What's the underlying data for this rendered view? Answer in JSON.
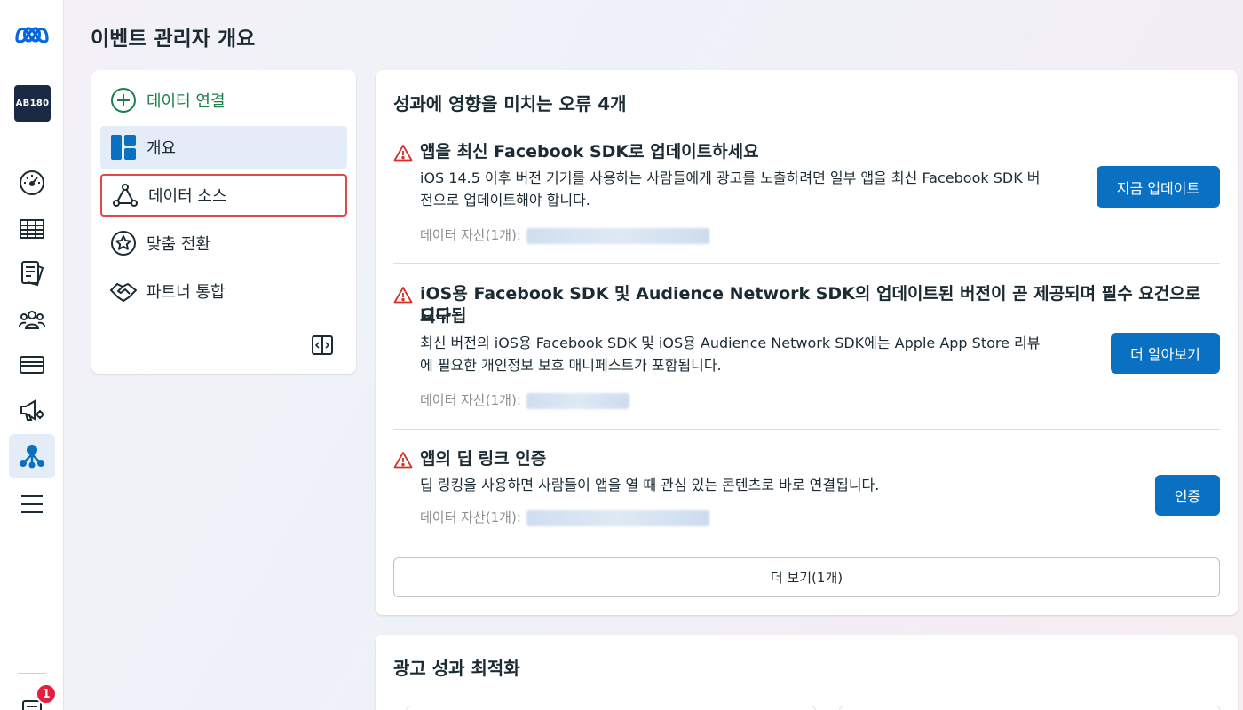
{
  "rail": {
    "account_label": "AB180",
    "notification_count": "1",
    "icons": [
      "meta-logo-icon",
      "dashboard-gauge-icon",
      "table-icon",
      "reports-icon",
      "audiences-icon",
      "billing-card-icon",
      "ads-megaphone-icon",
      "events-manager-icon",
      "menu-icon",
      "notifications-icon"
    ]
  },
  "page": {
    "title": "이벤트 관리자 개요"
  },
  "menu": {
    "connect": "데이터 연결",
    "overview": "개요",
    "data_sources": "데이터 소스",
    "custom_conversions": "맞춤 전환",
    "partner_integrations": "파트너 통합"
  },
  "issues_card": {
    "heading": "성과에 영향을 미치는 오류 4개",
    "issues": [
      {
        "title": "앱을 최신 Facebook SDK로 업데이트하세요",
        "desc_line1": "iOS 14.5 이후 버전 기기를 사용하는 사람들에게 광고를 노출하려면 일부 앱을 최신 Facebook SDK 버",
        "desc_line2": "전으로 업데이트해야 합니다.",
        "asset_label": "데이터 자산(1개):",
        "button": "지금 업데이트"
      },
      {
        "title_line1": "iOS용 Facebook SDK 및 Audience Network SDK의 업데이트된 버전이 곧 제공되며 필수 요건으로 요구됩",
        "title_line2": "니다",
        "desc_line1": "최신 버전의 iOS용 Facebook SDK 및 iOS용 Audience Network SDK에는 Apple App Store 리뷰",
        "desc_line2": "에 필요한 개인정보 보호 매니페스트가 포함됩니다.",
        "asset_label": "데이터 자산(1개):",
        "button": "더 알아보기"
      },
      {
        "title": "앱의 딥 링크 인증",
        "desc_line1": "딥 링킹을 사용하면 사람들이 앱을 열 때 관심 있는 콘텐츠로 바로 연결됩니다.",
        "asset_label": "데이터 자산(1개):",
        "button": "인증"
      }
    ],
    "more_button": "더 보기(1개)"
  },
  "perf_card": {
    "heading": "광고 성과 최적화"
  },
  "colors": {
    "primary": "#0a70c2",
    "warning": "#d93025",
    "connect_green": "#1a7f4b",
    "highlight_border": "#e0484c",
    "active_bg": "#e3ecf7"
  }
}
